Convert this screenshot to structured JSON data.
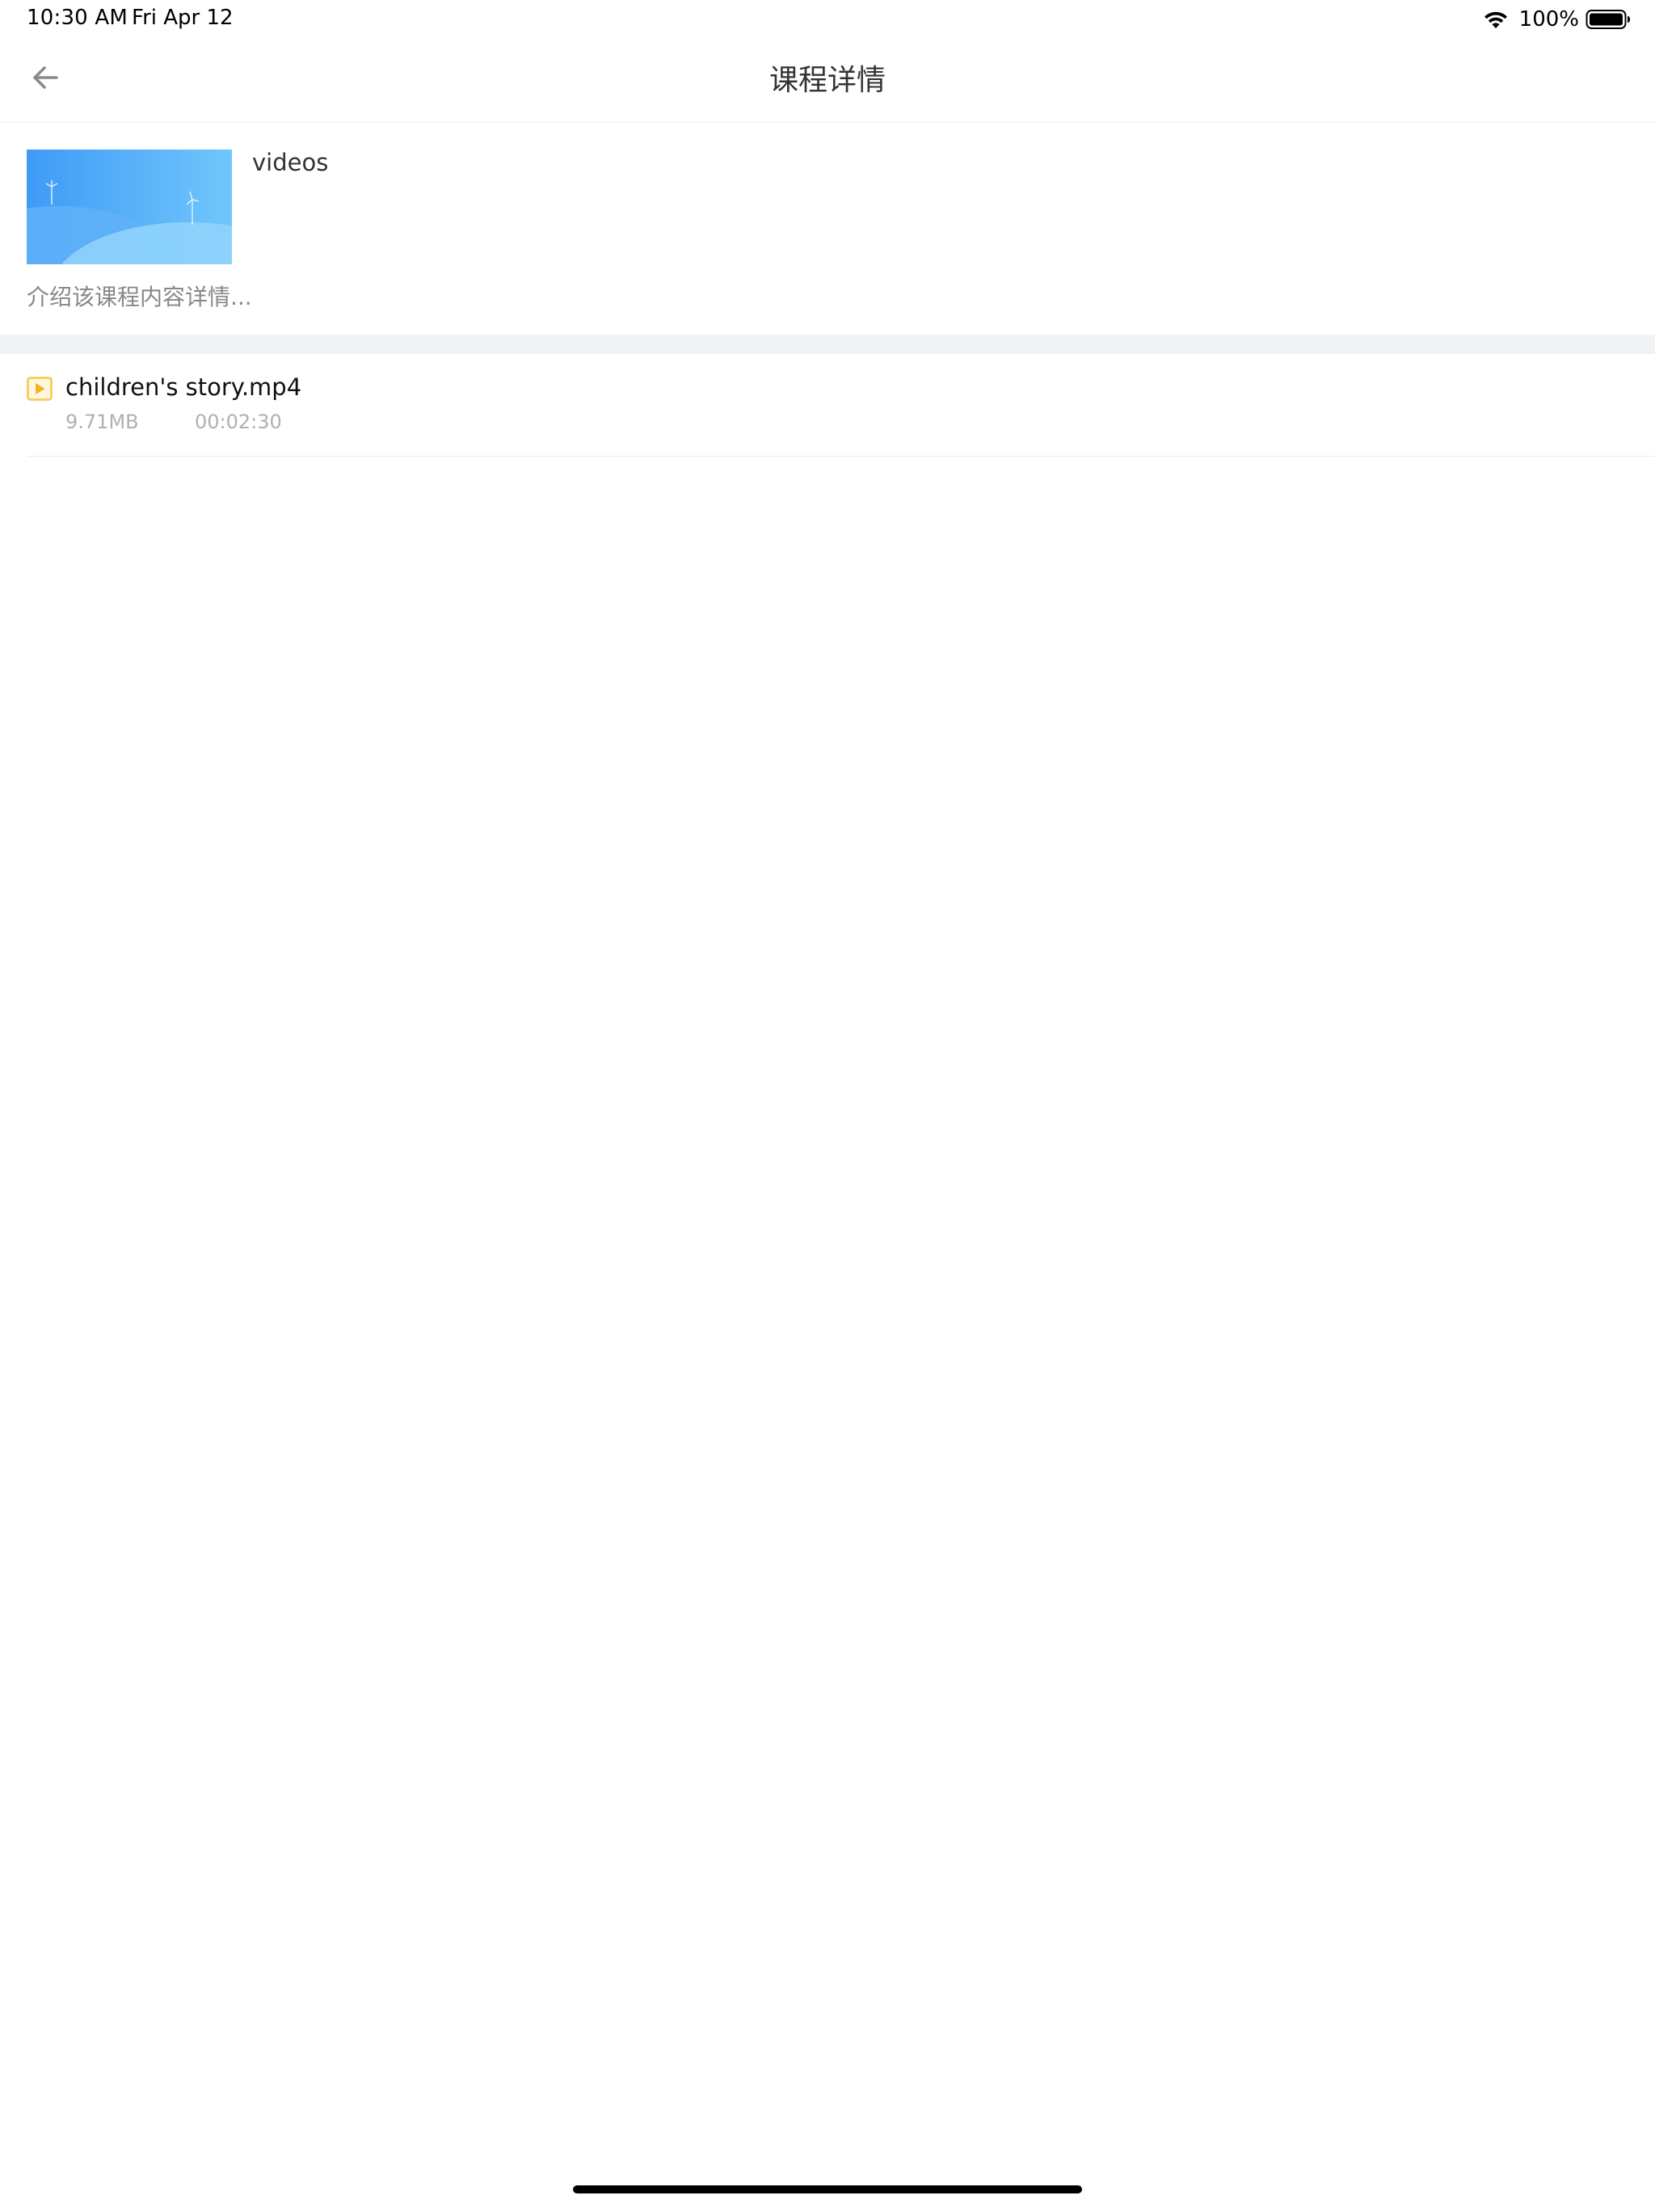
{
  "status_bar": {
    "time": "10:30 AM",
    "date": "Fri Apr 12",
    "battery_percent": "100%"
  },
  "nav": {
    "title": "课程详情",
    "back_icon": "arrow-left-icon"
  },
  "course": {
    "name": "videos",
    "description": "介绍该课程内容详情...",
    "cover_icon": "cover-image"
  },
  "files": [
    {
      "name": "children's story.mp4",
      "size": "9.71MB",
      "duration": "00:02:30",
      "icon": "video-file-icon"
    }
  ],
  "colors": {
    "accent_file_icon": "#f7c948",
    "cover_gradient_start": "#4aa3f7",
    "cover_gradient_end": "#7fccfb",
    "section_gap": "#f1f2f4"
  }
}
